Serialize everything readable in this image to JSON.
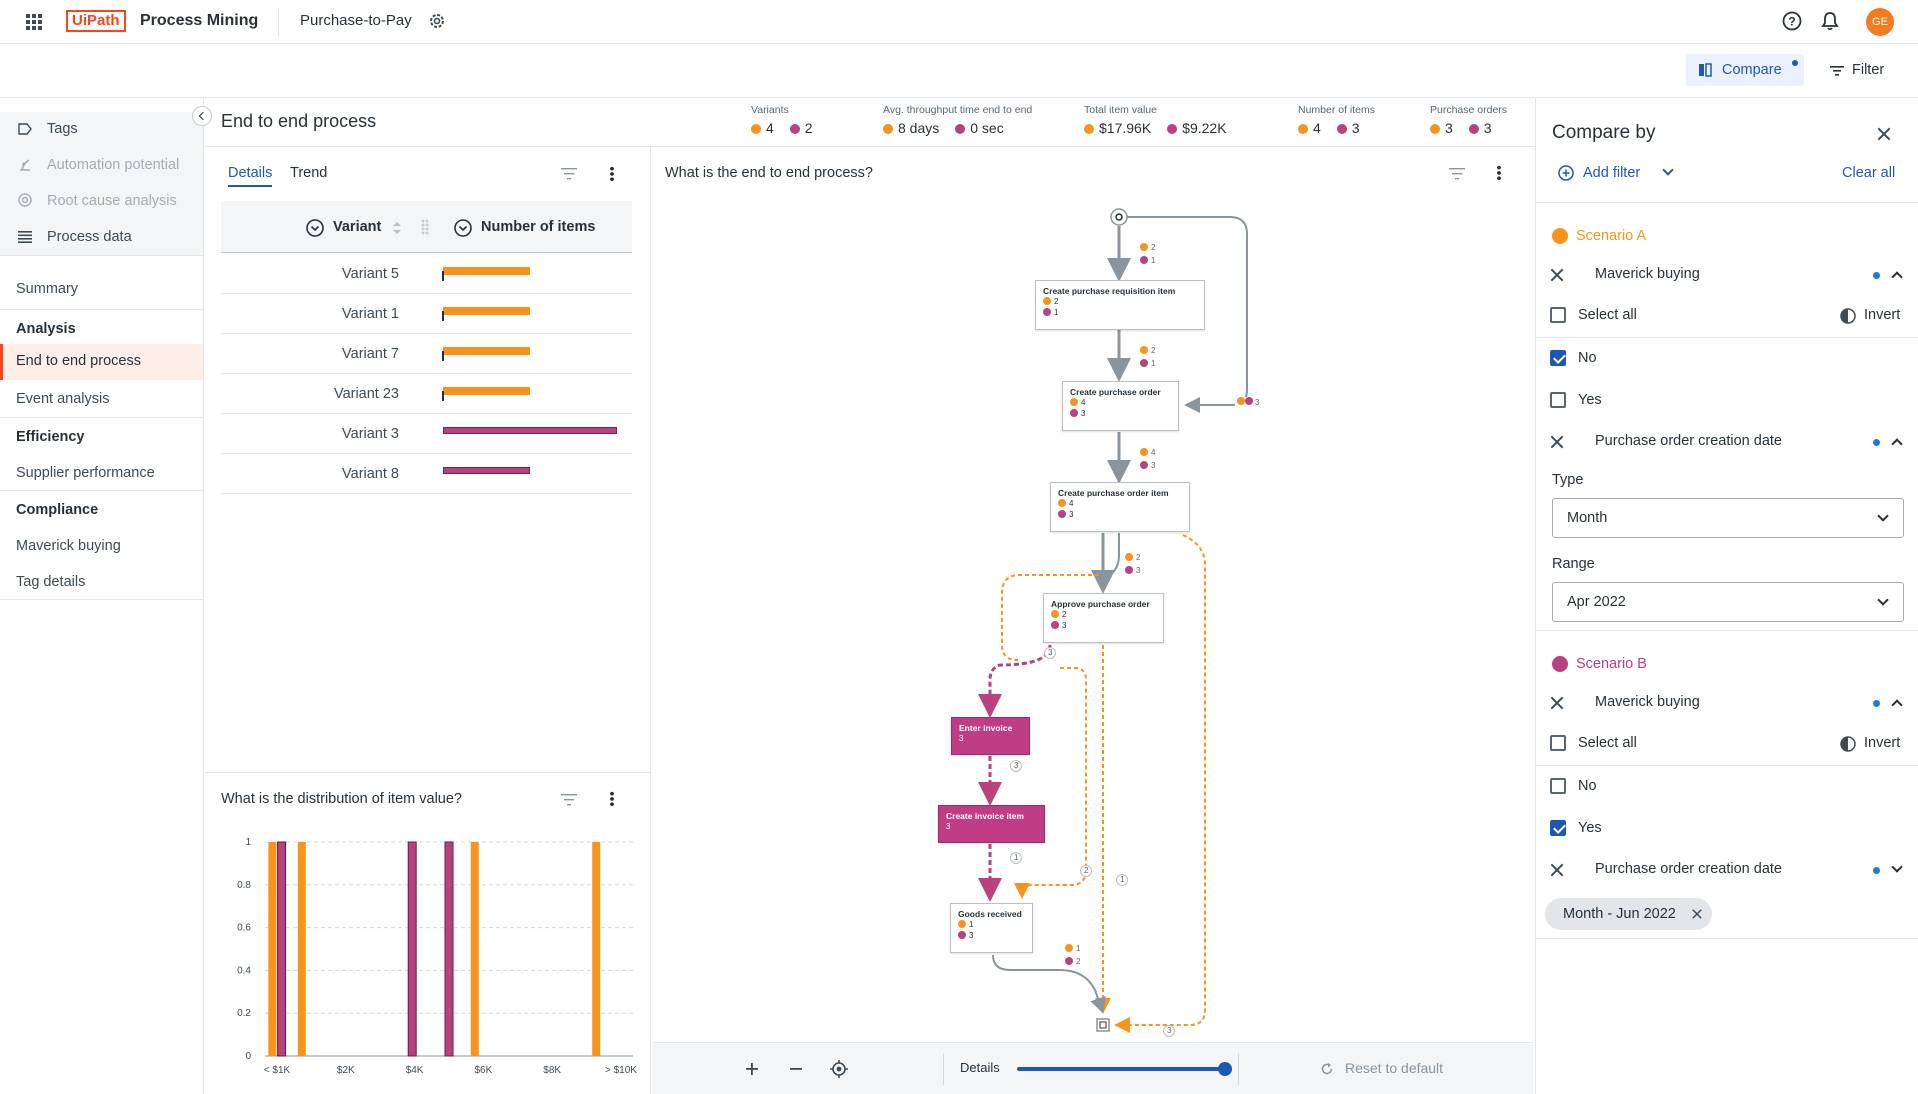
{
  "header": {
    "logo_text": "UiPath",
    "product": "Process Mining",
    "app_name": "Purchase-to-Pay",
    "avatar_initials": "GE"
  },
  "subbar": {
    "compare_label": "Compare",
    "filter_label": "Filter"
  },
  "sidebar": {
    "top_items": [
      {
        "label": "Tags",
        "icon": "tag-icon",
        "enabled": true
      },
      {
        "label": "Automation potential",
        "icon": "robot-arm-icon",
        "enabled": false
      },
      {
        "label": "Root cause analysis",
        "icon": "target-icon",
        "enabled": false
      },
      {
        "label": "Process data",
        "icon": "list-icon",
        "enabled": true
      }
    ],
    "summary": "Summary",
    "groups": [
      {
        "header": "Analysis",
        "items": [
          "End to end process",
          "Event analysis"
        ]
      },
      {
        "header": "Efficiency",
        "items": [
          "Supplier performance"
        ]
      },
      {
        "header": "Compliance",
        "items": [
          "Maverick buying",
          "Tag details"
        ]
      }
    ],
    "active_item": "End to end process"
  },
  "page": {
    "title": "End to end process"
  },
  "kpis": [
    {
      "label": "Variants",
      "a": "4",
      "b": "2"
    },
    {
      "label": "Avg. throughput time end to end",
      "a": "8 days",
      "b": "0 sec"
    },
    {
      "label": "Total item value",
      "a": "$17.96K",
      "b": "$9.22K"
    },
    {
      "label": "Number of items",
      "a": "4",
      "b": "3"
    },
    {
      "label": "Purchase orders",
      "a": "3",
      "b": "3"
    }
  ],
  "variants_panel": {
    "tabs": [
      "Details",
      "Trend"
    ],
    "active_tab": "Details",
    "col_variant": "Variant",
    "col_items": "Number of items",
    "rows": [
      {
        "name": "Variant 5",
        "scenario": "A",
        "value": 0.5
      },
      {
        "name": "Variant 1",
        "scenario": "A",
        "value": 0.5
      },
      {
        "name": "Variant 7",
        "scenario": "A",
        "value": 0.5
      },
      {
        "name": "Variant 23",
        "scenario": "A",
        "value": 0.5
      },
      {
        "name": "Variant 3",
        "scenario": "B",
        "value": 1.0
      },
      {
        "name": "Variant 8",
        "scenario": "B",
        "value": 0.5
      }
    ]
  },
  "distribution_panel": {
    "title": "What is the distribution of item value?"
  },
  "chart_data": {
    "type": "bar",
    "title": "What is the distribution of item value?",
    "xlabel": "",
    "ylabel": "",
    "ylim": [
      0,
      1
    ],
    "yticks": [
      "0",
      "0.2",
      "0.4",
      "0.6",
      "0.8",
      "1"
    ],
    "xticks": [
      "< $1K",
      "$2K",
      "$4K",
      "$6K",
      "$8K",
      "> $10K"
    ],
    "bars": [
      {
        "x": 0.2,
        "series": "A",
        "value": 1
      },
      {
        "x": 0.45,
        "series": "B",
        "value": 1
      },
      {
        "x": 1.0,
        "series": "A",
        "value": 1
      },
      {
        "x": 4.0,
        "series": "B",
        "value": 1
      },
      {
        "x": 5.0,
        "series": "B",
        "value": 1
      },
      {
        "x": 5.7,
        "series": "A",
        "value": 1
      },
      {
        "x": 9.0,
        "series": "A",
        "value": 1
      }
    ]
  },
  "process_panel": {
    "title": "What is the end to end process?",
    "nodes": [
      {
        "label": "Create purchase requisition item",
        "a": "2",
        "b": "1"
      },
      {
        "label": "Create purchase order",
        "a": "4",
        "b": "3"
      },
      {
        "label": "Create purchase order item",
        "a": "4",
        "b": "3"
      },
      {
        "label": "Approve purchase order",
        "a": "2",
        "b": "3"
      },
      {
        "label": "Enter invoice",
        "b": "3"
      },
      {
        "label": "Create invoice item",
        "b": "3"
      },
      {
        "label": "Goods received",
        "a": "1",
        "b": "3"
      }
    ],
    "edge_labels": [
      "2",
      "1",
      "2",
      "1",
      "4",
      "3",
      "2",
      "3",
      "3",
      "3",
      "3",
      "1",
      "2",
      "1",
      "3",
      "1",
      "2"
    ],
    "bottom": {
      "details_label": "Details",
      "detail_level": 1.0,
      "reset_label": "Reset to default"
    }
  },
  "compare_panel": {
    "title": "Compare by",
    "add_filter": "Add filter",
    "clear_all": "Clear all",
    "scenario_a": {
      "name": "Scenario A",
      "filter1": "Maverick buying",
      "select_all": "Select all",
      "invert": "Invert",
      "options": [
        {
          "label": "No",
          "checked": true
        },
        {
          "label": "Yes",
          "checked": false
        }
      ],
      "filter2": "Purchase order creation date",
      "type_label": "Type",
      "type_value": "Month",
      "range_label": "Range",
      "range_value": "Apr 2022"
    },
    "scenario_b": {
      "name": "Scenario B",
      "filter1": "Maverick buying",
      "select_all": "Select all",
      "invert": "Invert",
      "options": [
        {
          "label": "No",
          "checked": false
        },
        {
          "label": "Yes",
          "checked": true
        }
      ],
      "filter2": "Purchase order creation date",
      "chip": "Month - Jun 2022"
    }
  },
  "colors": {
    "scenario_a": "#f7941d",
    "scenario_b": "#b8417e",
    "accent": "#1d58b5",
    "logo": "#fa4616"
  }
}
